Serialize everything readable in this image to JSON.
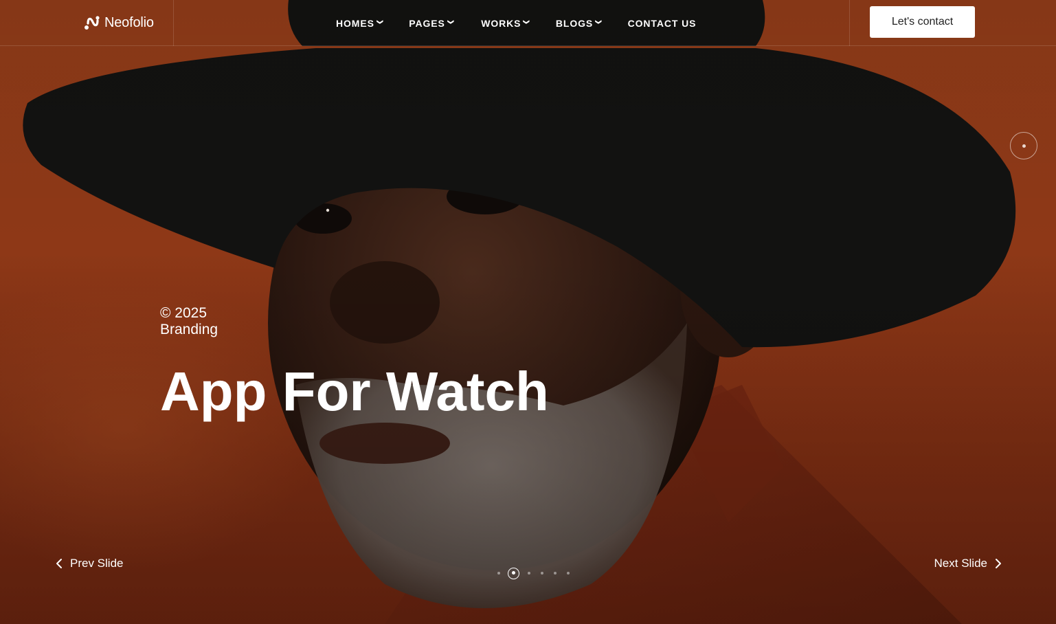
{
  "brand": {
    "name": "Neofolio",
    "logo_icon": "neofolio-logo-icon"
  },
  "nav": {
    "items": [
      {
        "label": "HOMES",
        "has_dropdown": true
      },
      {
        "label": "PAGES",
        "has_dropdown": true
      },
      {
        "label": "WORKS",
        "has_dropdown": true
      },
      {
        "label": "BLOGS",
        "has_dropdown": true
      },
      {
        "label": "CONTACT US",
        "has_dropdown": false
      }
    ],
    "dropdown_icon": "chevron-down-icon"
  },
  "header": {
    "cta_label": "Let's contact"
  },
  "slide": {
    "year": "© 2025",
    "category": "Branding",
    "title": "App For Watch",
    "background_image": "portrait of bearded man in black wide-brim hat on orange background"
  },
  "slider_controls": {
    "prev_label": "Prev Slide",
    "next_label": "Next Slide",
    "prev_icon": "chevron-left-icon",
    "next_icon": "chevron-right-icon",
    "total_slides": 6,
    "active_slide_index": 1
  },
  "colors": {
    "background": "#8a3618",
    "text": "#ffffff",
    "cta_bg": "#ffffff",
    "cta_text": "#222222"
  }
}
